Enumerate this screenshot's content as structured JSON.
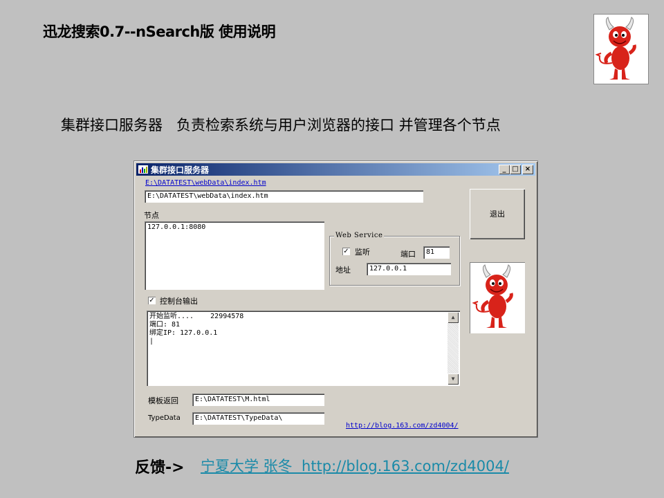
{
  "slide": {
    "title": "迅龙搜索0.7--nSearch版  使用说明",
    "subtitle": "集群接口服务器   负责检索系统与用户浏览器的接口 并管理各个节点"
  },
  "window": {
    "title": "集群接口服务器",
    "minimize_glyph": "_",
    "maximize_glyph": "□",
    "close_glyph": "×",
    "path_link": "E:\\DATATEST\\webData\\index.htm",
    "path_value": "E:\\DATATEST\\webData\\index.htm",
    "exit_button": "退出",
    "nodes_label": "节点",
    "nodes": [
      "127.0.0.1:8080"
    ],
    "web_service": {
      "legend": "Web Service",
      "listen_label": "监听",
      "listen_checked": true,
      "port_label": "端口",
      "port_value": "81",
      "address_label": "地址",
      "address_value": "127.0.0.1"
    },
    "console_output_label": "控制台输出",
    "console_output_checked": true,
    "console_lines": [
      "开始监听....    22994578",
      "端口: 81",
      "绑定IP: 127.0.0.1",
      "|"
    ],
    "template_label": "模板返回",
    "template_value": "E:\\DATATEST\\M.html",
    "typedata_label": "TypeData",
    "typedata_value": "E:\\DATATEST\\TypeData\\",
    "blog_link": "http://blog.163.com/zd4004/"
  },
  "footer": {
    "label": "反馈->",
    "link": "宁夏大学 张冬  http://blog.163.com/zd4004/"
  },
  "icons": {
    "mascot": "bsd-daemon-icon",
    "app": "window-app-icon"
  }
}
